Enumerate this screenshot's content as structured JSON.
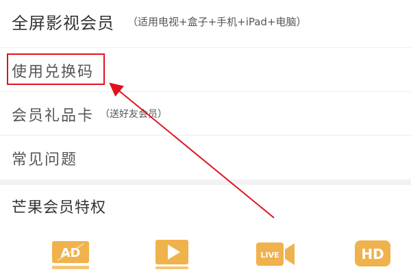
{
  "header": {
    "title": "全屏影视会员",
    "note": "（适用电视+盒子+手机+iPad+电脑）"
  },
  "menu": [
    {
      "label": "使用兑换码",
      "note": ""
    },
    {
      "label": "会员礼品卡",
      "note": "（送好友会员）"
    },
    {
      "label": "常见问题",
      "note": ""
    }
  ],
  "privileges": {
    "title": "芒果会员特权",
    "icons": [
      {
        "icon": "ad-free-icon",
        "text": "AD"
      },
      {
        "icon": "play-icon",
        "text": ""
      },
      {
        "icon": "live-icon",
        "text": "LIVE"
      },
      {
        "icon": "hd-icon",
        "text": "HD"
      }
    ]
  },
  "colors": {
    "accent_gold": "#f0b24d",
    "highlight_red": "#e0121b",
    "text": "#333333"
  }
}
